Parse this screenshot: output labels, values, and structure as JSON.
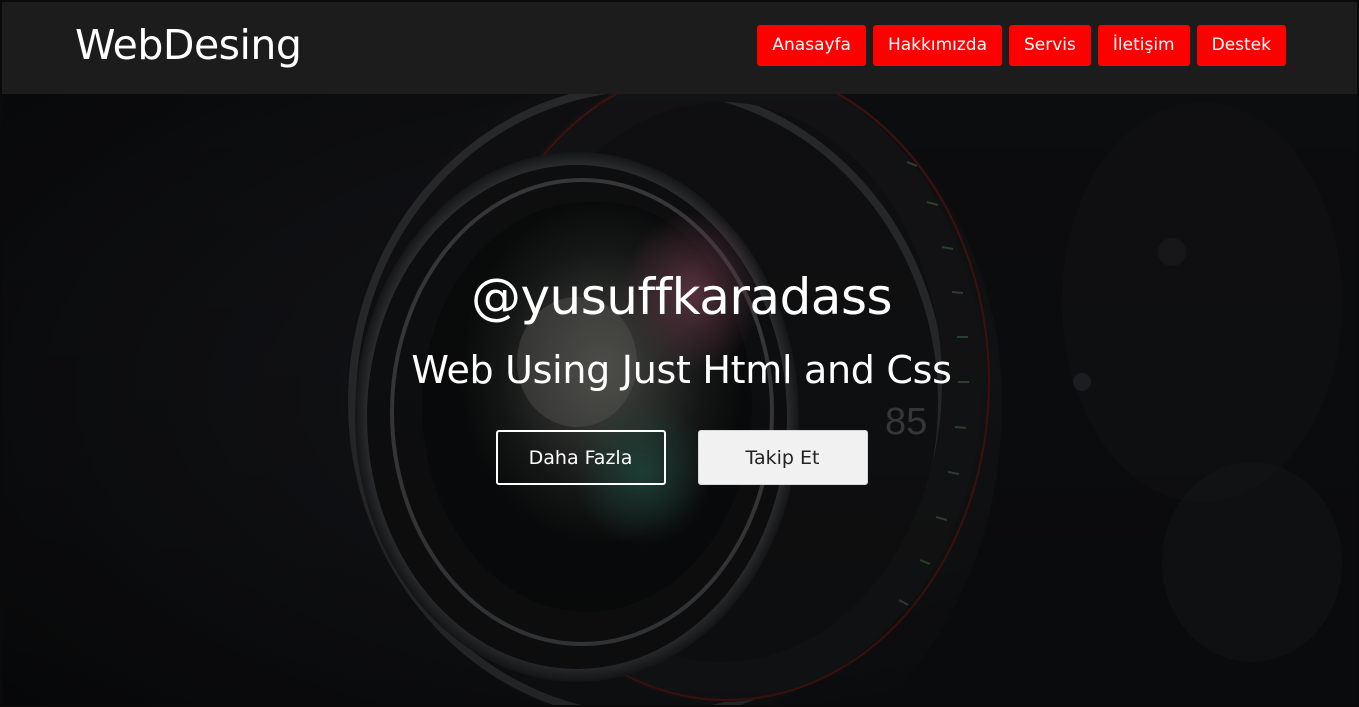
{
  "header": {
    "logo_text": "WebDesing",
    "nav_items": [
      {
        "label": "Anasayfa"
      },
      {
        "label": "Hakkımızda"
      },
      {
        "label": "Servis"
      },
      {
        "label": "İletişim"
      },
      {
        "label": "Destek"
      }
    ]
  },
  "hero": {
    "background": "camera-lens-photo",
    "title": "@yusuffkaradass",
    "subtitle": "Web Using Just Html and Css",
    "buttons": {
      "primary_label": "Daha Fazla",
      "secondary_label": "Takip Et"
    },
    "lens_marking": "85"
  },
  "colors": {
    "header_bg": "#1c1c1c",
    "nav_button_bg": "#ff0000",
    "text_primary": "#ffffff",
    "secondary_button_bg": "#f1f1f1"
  }
}
